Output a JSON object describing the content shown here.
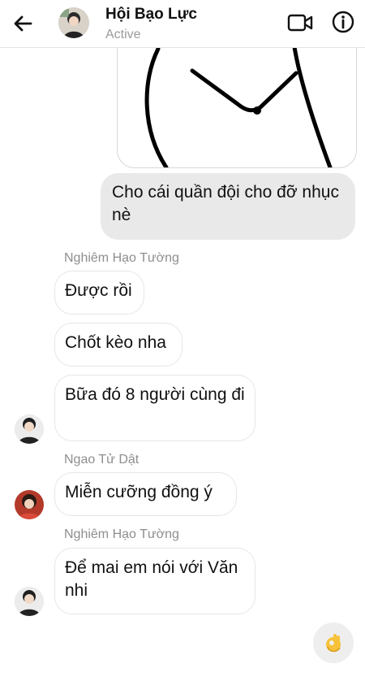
{
  "header": {
    "title": "Hội Bạo Lực",
    "status": "Active",
    "icons": [
      "back-arrow-icon",
      "video-call-icon",
      "info-icon"
    ]
  },
  "messages": [
    {
      "type": "outgoing",
      "text": "Cho cái quần đội cho đỡ nhục nè"
    },
    {
      "type": "incoming",
      "sender": "Nghiêm Hạo Tường",
      "bubbles": [
        "Được rồi",
        "Chốt kèo nha",
        "Bữa đó 8 người cùng đi"
      ]
    },
    {
      "type": "incoming",
      "sender": "Ngao Tử Dật",
      "bubbles": [
        "Miễn cưỡng đồng ý"
      ]
    },
    {
      "type": "incoming",
      "sender": "Nghiêm Hạo Tường",
      "bubbles": [
        "Để mai em nói với Văn nhi"
      ]
    }
  ],
  "footer": {
    "reaction_icon": "ok-hand-emoji-icon"
  }
}
